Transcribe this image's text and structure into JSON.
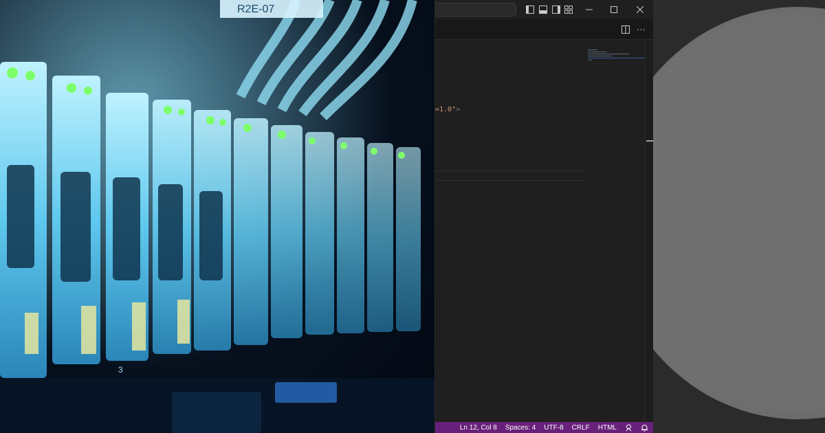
{
  "colors": {
    "status_bar": "#68217a",
    "editor_bg": "#1f1f1f",
    "string_token": "#ce9178",
    "disc": "#707070",
    "rack_glow": "#3fd7ff",
    "led_green": "#7dff6a"
  },
  "photo": {
    "label_top": "R2E-07",
    "bay_number": "3"
  },
  "editor": {
    "code_fragment": "=1.0\"",
    "code_close": ">"
  },
  "titlebar": {
    "icons": [
      "toggle-primary-sidebar-icon",
      "toggle-panel-icon",
      "toggle-secondary-sidebar-icon",
      "customize-layout-icon"
    ],
    "window_controls": [
      "minimize-icon",
      "maximize-icon",
      "close-icon"
    ]
  },
  "editor_actions": {
    "split_icon": "split-editor-icon",
    "more_label": "···"
  },
  "status_bar": {
    "position": "Ln 12, Col 8",
    "indent": "Spaces: 4",
    "encoding": "UTF-8",
    "eol": "CRLF",
    "language": "HTML"
  }
}
